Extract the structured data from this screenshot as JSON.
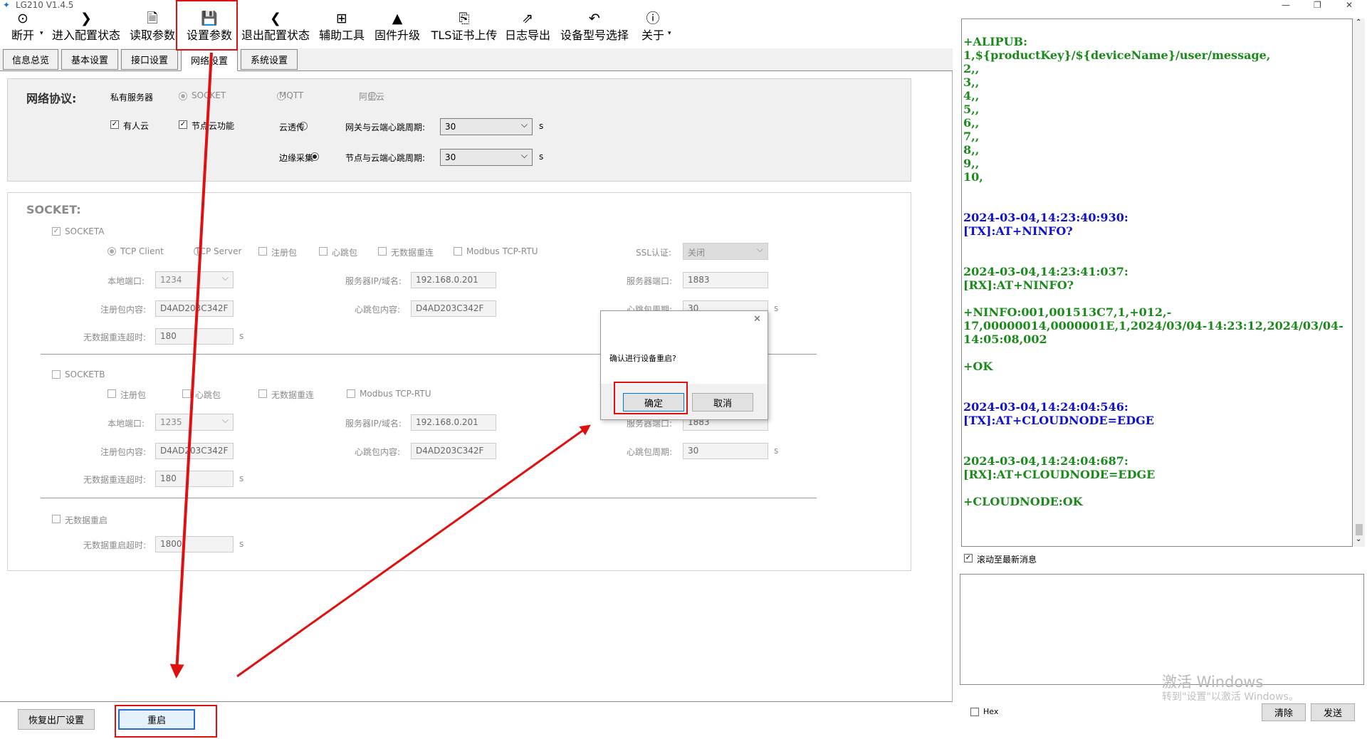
{
  "window": {
    "title": "LG210 V1.4.5",
    "minimize": "—",
    "restore": "❐",
    "close": "✕"
  },
  "toolbar": [
    {
      "label": "断开",
      "icon": "location-icon",
      "glyph": "⊙"
    },
    {
      "label": "进入配置状态",
      "icon": "chevron-right-icon",
      "glyph": "❯"
    },
    {
      "label": "读取参数",
      "icon": "read-icon",
      "glyph": "🗎"
    },
    {
      "label": "设置参数",
      "icon": "save-icon",
      "glyph": "💾"
    },
    {
      "label": "退出配置状态",
      "icon": "chevron-left-icon",
      "glyph": "❮"
    },
    {
      "label": "辅助工具",
      "icon": "toolbox-icon",
      "glyph": "⊞"
    },
    {
      "label": "固件升级",
      "icon": "rocket-icon",
      "glyph": "▲"
    },
    {
      "label": "TLS证书上传",
      "icon": "certificate-icon",
      "glyph": "⎘"
    },
    {
      "label": "日志导出",
      "icon": "export-icon",
      "glyph": "⇗"
    },
    {
      "label": "设备型号选择",
      "icon": "undo-icon",
      "glyph": "↶"
    },
    {
      "label": "关于",
      "icon": "info-icon",
      "glyph": "ⓘ"
    }
  ],
  "tabs": [
    "信息总览",
    "基本设置",
    "接口设置",
    "网络设置",
    "系统设置"
  ],
  "network": {
    "title": "网络协议:",
    "private_server": "私有服务器",
    "socket": "SOCKET",
    "mqtt": "MQTT",
    "aliyun": "阿里云",
    "usr_cloud": "有人云",
    "node_cloud": "节点云功能",
    "cloud_transparent": "云透传",
    "edge_collect": "边缘采集",
    "gw_heartbeat_label": "网关与云端心跳周期:",
    "gw_heartbeat": "30",
    "node_heartbeat_label": "节点与云端心跳周期:",
    "node_heartbeat": "30",
    "unit_s": "s"
  },
  "socket": {
    "title": "SOCKET:",
    "a": {
      "name": "SOCKETA",
      "tcp_client": "TCP Client",
      "tcp_server": "TCP Server",
      "reg_pkg": "注册包",
      "heartbeat_pkg": "心跳包",
      "no_data_reconnect": "无数据重连",
      "modbus": "Modbus TCP-RTU",
      "ssl_label": "SSL认证:",
      "ssl": "关闭",
      "local_port_label": "本地端口:",
      "local_port": "1234",
      "server_ip_label": "服务器IP/域名:",
      "server_ip": "192.168.0.201",
      "server_port_label": "服务器端口:",
      "server_port": "1883",
      "reg_content_label": "注册包内容:",
      "reg_content": "D4AD203C342F",
      "hb_content_label": "心跳包内容:",
      "hb_content": "D4AD203C342F",
      "hb_period_label": "心跳包周期:",
      "hb_period": "30",
      "timeout_label": "无数据重连超时:",
      "timeout": "180"
    },
    "b": {
      "name": "SOCKETB",
      "reg_pkg": "注册包",
      "heartbeat_pkg": "心跳包",
      "no_data_reconnect": "无数据重连",
      "modbus": "Modbus TCP-RTU",
      "local_port_label": "本地端口:",
      "local_port": "1235",
      "server_ip_label": "服务器IP/域名:",
      "server_ip": "192.168.0.201",
      "server_port_label": "服务器端口:",
      "server_port": "1883",
      "reg_content_label": "注册包内容:",
      "reg_content": "D4AD203C342F",
      "hb_content_label": "心跳包内容:",
      "hb_content": "D4AD203C342F",
      "hb_period_label": "心跳包周期:",
      "hb_period": "30",
      "timeout_label": "无数据重连超时:",
      "timeout": "180"
    },
    "restart": {
      "name": "无数据重启",
      "timeout_label": "无数据重启超时:",
      "timeout": "1800"
    }
  },
  "bottom": {
    "factory_reset": "恢复出厂设置",
    "reboot": "重启"
  },
  "dialog": {
    "message": "确认进行设备重启?",
    "ok": "确定",
    "cancel": "取消",
    "close": "✕"
  },
  "log": [
    {
      "c": "gr",
      "t": "+ALIPUB:"
    },
    {
      "c": "gr",
      "t": "1,${productKey}/${deviceName}/user/message,"
    },
    {
      "c": "gr",
      "t": "2,,"
    },
    {
      "c": "gr",
      "t": "3,,"
    },
    {
      "c": "gr",
      "t": "4,,"
    },
    {
      "c": "gr",
      "t": "5,,"
    },
    {
      "c": "gr",
      "t": "6,,"
    },
    {
      "c": "gr",
      "t": "7,,"
    },
    {
      "c": "gr",
      "t": "8,,"
    },
    {
      "c": "gr",
      "t": "9,,"
    },
    {
      "c": "gr",
      "t": "10,"
    },
    {
      "c": "gr",
      "t": ""
    },
    {
      "c": "gr",
      "t": ""
    },
    {
      "c": "bl",
      "t": "2024-03-04,14:23:40:930:"
    },
    {
      "c": "bl",
      "t": "[TX]:AT+NINFO?"
    },
    {
      "c": "gr",
      "t": ""
    },
    {
      "c": "gr",
      "t": ""
    },
    {
      "c": "gr",
      "t": "2024-03-04,14:23:41:037:"
    },
    {
      "c": "gr",
      "t": "[RX]:AT+NINFO?"
    },
    {
      "c": "gr",
      "t": ""
    },
    {
      "c": "gr",
      "t": "+NINFO:001,001513C7,1,+012,-"
    },
    {
      "c": "gr",
      "t": "17,00000014,0000001E,1,2024/03/04-14:23:12,2024/03/04-"
    },
    {
      "c": "gr",
      "t": "14:05:08,002"
    },
    {
      "c": "gr",
      "t": ""
    },
    {
      "c": "gr",
      "t": "+OK"
    },
    {
      "c": "gr",
      "t": ""
    },
    {
      "c": "gr",
      "t": ""
    },
    {
      "c": "bl",
      "t": "2024-03-04,14:24:04:546:"
    },
    {
      "c": "bl",
      "t": "[TX]:AT+CLOUDNODE=EDGE"
    },
    {
      "c": "gr",
      "t": ""
    },
    {
      "c": "gr",
      "t": ""
    },
    {
      "c": "gr",
      "t": "2024-03-04,14:24:04:687:"
    },
    {
      "c": "gr",
      "t": "[RX]:AT+CLOUDNODE=EDGE"
    },
    {
      "c": "gr",
      "t": ""
    },
    {
      "c": "gr",
      "t": "+CLOUDNODE:OK"
    }
  ],
  "scroll_latest": "滚动至最新消息",
  "hex": "Hex",
  "clear": "清除",
  "send": "发送",
  "watermark": "激活 Windows",
  "watermark_sub": "转到\"设置\"以激活 Windows。"
}
